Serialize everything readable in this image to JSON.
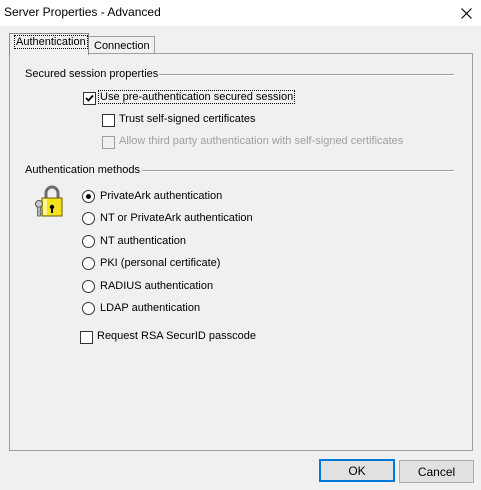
{
  "window": {
    "title": "Server Properties - Advanced"
  },
  "tabs": [
    {
      "label": "Authentication",
      "selected": true
    },
    {
      "label": "Connection",
      "selected": false
    }
  ],
  "secured_session": {
    "group_label": "Secured session properties",
    "use_pre_auth": {
      "label": "Use pre-authentication secured session",
      "checked": true
    },
    "trust_self_signed": {
      "label": "Trust self-signed certificates",
      "checked": false
    },
    "allow_third_party": {
      "label": "Allow third party authentication with self-signed certificates",
      "checked": false,
      "disabled": true
    }
  },
  "auth_methods": {
    "group_label": "Authentication methods",
    "icon": "padlock-keys-icon",
    "options": [
      {
        "label": "PrivateArk authentication",
        "selected": true
      },
      {
        "label": "NT or PrivateArk authentication",
        "selected": false
      },
      {
        "label": "NT authentication",
        "selected": false
      },
      {
        "label": "PKI (personal certificate)",
        "selected": false
      },
      {
        "label": "RADIUS authentication",
        "selected": false
      },
      {
        "label": "LDAP authentication",
        "selected": false
      }
    ],
    "rsa_securid": {
      "label": "Request RSA SecurID passcode",
      "checked": false
    }
  },
  "buttons": {
    "ok": "OK",
    "cancel": "Cancel"
  }
}
